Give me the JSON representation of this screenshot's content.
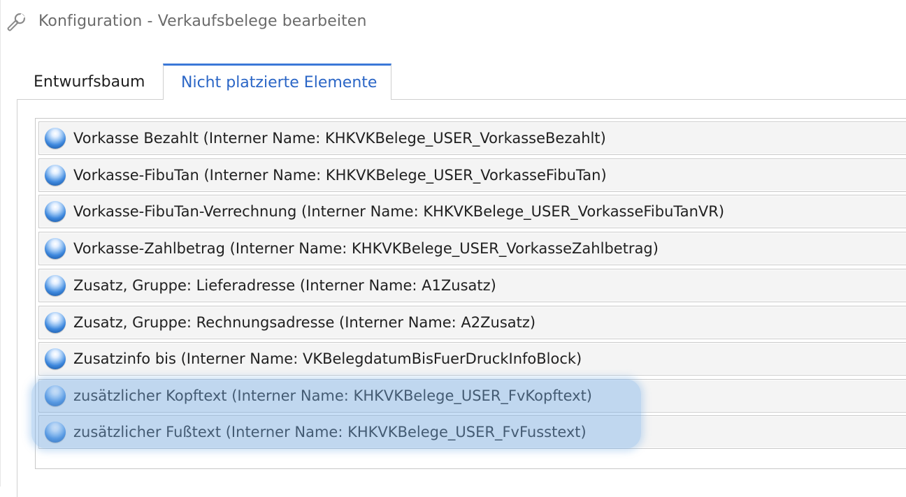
{
  "window": {
    "title": "Konfiguration - Verkaufsbelege bearbeiten",
    "icon": "wrench-icon"
  },
  "tabs": [
    {
      "label": "Entwurfsbaum",
      "active": false
    },
    {
      "label": "Nicht platzierte Elemente",
      "active": true
    }
  ],
  "colors": {
    "accent": "#3b78d8",
    "active_tab_text": "#2b66c6",
    "highlight": "#78afe6"
  },
  "list": {
    "item_icon": "blue-ball-icon",
    "items": [
      {
        "label": "Vorkasse Bezahlt (Interner Name: KHKVKBelege_USER_VorkasseBezahlt)",
        "highlighted": false
      },
      {
        "label": "Vorkasse-FibuTan (Interner Name: KHKVKBelege_USER_VorkasseFibuTan)",
        "highlighted": false
      },
      {
        "label": "Vorkasse-FibuTan-Verrechnung (Interner Name: KHKVKBelege_USER_VorkasseFibuTanVR)",
        "highlighted": false
      },
      {
        "label": "Vorkasse-Zahlbetrag (Interner Name: KHKVKBelege_USER_VorkasseZahlbetrag)",
        "highlighted": false
      },
      {
        "label": "Zusatz, Gruppe: Lieferadresse (Interner Name: A1Zusatz)",
        "highlighted": false
      },
      {
        "label": "Zusatz, Gruppe: Rechnungsadresse (Interner Name: A2Zusatz)",
        "highlighted": false
      },
      {
        "label": "Zusatzinfo bis (Interner Name: VKBelegdatumBisFuerDruckInfoBlock)",
        "highlighted": false
      },
      {
        "label": "zusätzlicher Kopftext (Interner Name: KHKVKBelege_USER_FvKopftext)",
        "highlighted": true
      },
      {
        "label": "zusätzlicher Fußtext (Interner Name: KHKVKBelege_USER_FvFusstext)",
        "highlighted": true
      }
    ]
  }
}
